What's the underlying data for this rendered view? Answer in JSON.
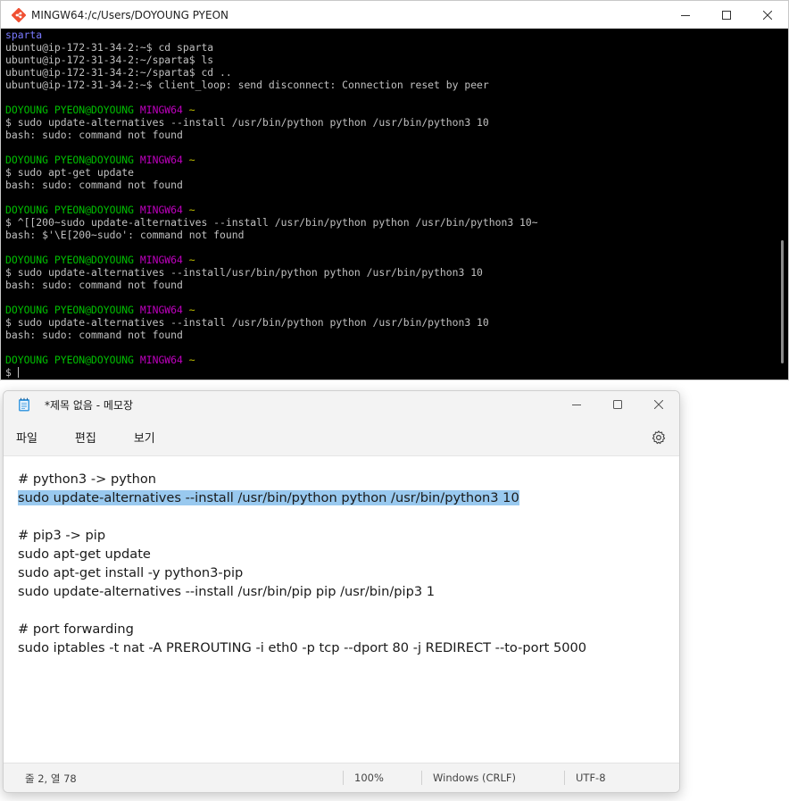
{
  "terminal": {
    "title": "MINGW64:/c/Users/DOYOUNG PYEON",
    "lines": [
      {
        "t": "blue",
        "text": "sparta"
      },
      {
        "t": "plain",
        "text": "ubuntu@ip-172-31-34-2:~$ cd sparta"
      },
      {
        "t": "plain",
        "text": "ubuntu@ip-172-31-34-2:~/sparta$ ls"
      },
      {
        "t": "plain",
        "text": "ubuntu@ip-172-31-34-2:~/sparta$ cd .."
      },
      {
        "t": "plain",
        "text": "ubuntu@ip-172-31-34-2:~$ client_loop: send disconnect: Connection reset by peer"
      },
      {
        "t": "blank",
        "text": ""
      },
      {
        "t": "prompt",
        "user": "DOYOUNG PYEON@DOYOUNG",
        "host": "MINGW64",
        "path": "~"
      },
      {
        "t": "plain",
        "text": "$ sudo update-alternatives --install /usr/bin/python python /usr/bin/python3 10"
      },
      {
        "t": "plain",
        "text": "bash: sudo: command not found"
      },
      {
        "t": "blank",
        "text": ""
      },
      {
        "t": "prompt",
        "user": "DOYOUNG PYEON@DOYOUNG",
        "host": "MINGW64",
        "path": "~"
      },
      {
        "t": "plain",
        "text": "$ sudo apt-get update"
      },
      {
        "t": "plain",
        "text": "bash: sudo: command not found"
      },
      {
        "t": "blank",
        "text": ""
      },
      {
        "t": "prompt",
        "user": "DOYOUNG PYEON@DOYOUNG",
        "host": "MINGW64",
        "path": "~"
      },
      {
        "t": "plain",
        "text": "$ ^[[200~sudo update-alternatives --install /usr/bin/python python /usr/bin/python3 10~"
      },
      {
        "t": "plain",
        "text": "bash: $'\\E[200~sudo': command not found"
      },
      {
        "t": "blank",
        "text": ""
      },
      {
        "t": "prompt",
        "user": "DOYOUNG PYEON@DOYOUNG",
        "host": "MINGW64",
        "path": "~"
      },
      {
        "t": "plain",
        "text": "$ sudo update-alternatives --install/usr/bin/python python /usr/bin/python3 10"
      },
      {
        "t": "plain",
        "text": "bash: sudo: command not found"
      },
      {
        "t": "blank",
        "text": ""
      },
      {
        "t": "prompt",
        "user": "DOYOUNG PYEON@DOYOUNG",
        "host": "MINGW64",
        "path": "~"
      },
      {
        "t": "plain",
        "text": "$ sudo update-alternatives --install /usr/bin/python python /usr/bin/python3 10"
      },
      {
        "t": "plain",
        "text": "bash: sudo: command not found"
      },
      {
        "t": "blank",
        "text": ""
      },
      {
        "t": "prompt",
        "user": "DOYOUNG PYEON@DOYOUNG",
        "host": "MINGW64",
        "path": "~"
      },
      {
        "t": "cursor",
        "text": "$ "
      }
    ]
  },
  "notepad": {
    "title": "*제목 없음 - 메모장",
    "menu": [
      "파일",
      "편집",
      "보기"
    ],
    "lines": [
      {
        "text": "# python3 -> python",
        "selected": false
      },
      {
        "text": "sudo update-alternatives --install /usr/bin/python python /usr/bin/python3 10",
        "selected": true
      },
      {
        "text": "",
        "selected": false
      },
      {
        "text": "# pip3 -> pip",
        "selected": false
      },
      {
        "text": "sudo apt-get update",
        "selected": false
      },
      {
        "text": "sudo apt-get install -y python3-pip",
        "selected": false
      },
      {
        "text": "sudo update-alternatives --install /usr/bin/pip pip /usr/bin/pip3 1",
        "selected": false
      },
      {
        "text": "",
        "selected": false
      },
      {
        "text": "# port forwarding",
        "selected": false
      },
      {
        "text": "sudo iptables -t nat -A PREROUTING -i eth0 -p tcp --dport 80 -j REDIRECT --to-port 5000",
        "selected": false
      }
    ],
    "status": {
      "position": "줄 2, 열 78",
      "zoom": "100%",
      "line_ending": "Windows (CRLF)",
      "encoding": "UTF-8"
    }
  },
  "colors": {
    "selection": "#99c9ef",
    "prompt_user": "#00c000",
    "prompt_host": "#c000c0",
    "prompt_path": "#c0c000"
  }
}
